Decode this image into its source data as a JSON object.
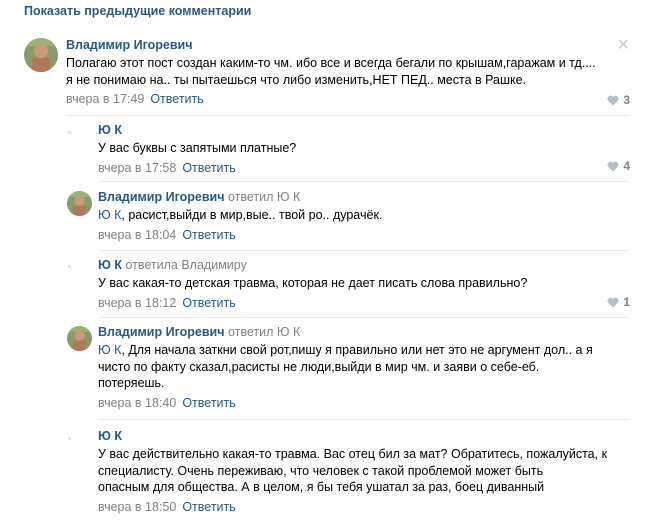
{
  "show_previous": "Показать предыдущие комментарии",
  "reply_label": "Ответить",
  "comments": [
    {
      "author": "Владимир Игоревич",
      "replied_to": "",
      "text_line1": "Полагаю этот пост создан каким-то чм. ибо все и всегда бегали по крышам,гаражам и тд....",
      "text_line2": "я не понимаю на.. ты пытаешься что либо изменить,НЕТ ПЕД.. места в Рашке.",
      "time": "вчера в 17:49",
      "likes": "3"
    },
    {
      "author": "Ю К",
      "replied_to": "",
      "text_line1": "У вас буквы с запятыми платные?",
      "time": "вчера в 17:58",
      "likes": "4"
    },
    {
      "author": "Владимир Игоревич",
      "replied_to": "ответил Ю К",
      "mention": "Ю К",
      "text_line1": ", расист,выйди в мир,вые.. твой ро.. дурачёк.",
      "time": "вчера в 18:04",
      "likes": ""
    },
    {
      "author": "Ю К",
      "replied_to": "ответила Владимиру",
      "text_line1": "У вас какая-то детская травма, которая не дает писать слова правильно?",
      "time": "вчера в 18:12",
      "likes": "1"
    },
    {
      "author": "Владимир Игоревич",
      "replied_to": "ответил Ю К",
      "mention": "Ю К",
      "text_line1": ", Для начала заткни свой рот,пишу я правильно или нет это не аргумент дол.. а я",
      "text_line2": "чисто по факту сказал,расисты не люди,выйди в мир чм. и заяви о себе-еб.",
      "text_line3": "потеряешь.",
      "time": "вчера в 18:40",
      "likes": ""
    },
    {
      "author": "Ю К",
      "replied_to": "",
      "text_line1": "У вас действительно какая-то травма. Вас отец бил за мат? Обратитесь, пожалуйста, к",
      "text_line2": "специалисту. Очень переживаю, что человек с такой проблемой может быть",
      "text_line3": "опасным для общества. А в целом, я бы тебя ушатал за раз, боец диванный",
      "time": "вчера в 18:50",
      "likes": ""
    }
  ],
  "colors": {
    "link": "#2a5885",
    "meta": "#828282",
    "separator": "#e7e8ec"
  },
  "icons": {
    "like": "heart-icon",
    "close": "close-icon"
  }
}
